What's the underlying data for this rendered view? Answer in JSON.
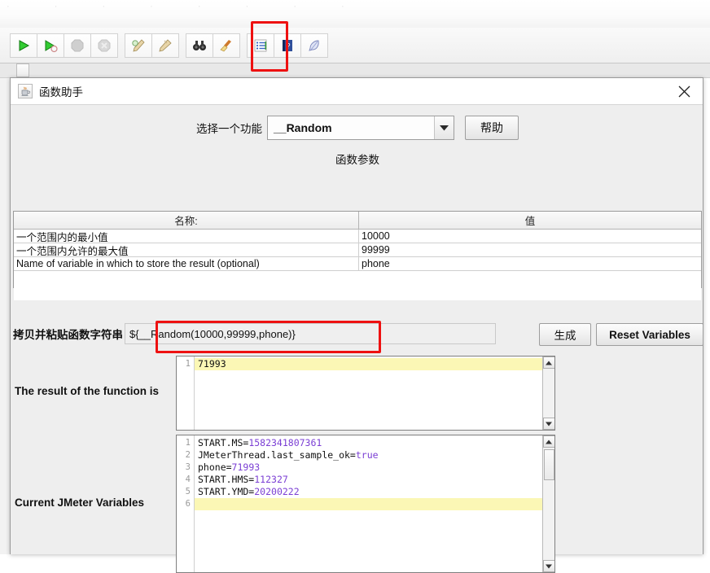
{
  "app": {
    "toolbar_buttons": [
      {
        "name": "start-button",
        "icon": "play-icon",
        "enabled": true
      },
      {
        "name": "start-no-pauses-button",
        "icon": "play-no-pause-icon",
        "enabled": true
      },
      {
        "name": "stop-button",
        "icon": "stop-octagon-icon",
        "enabled": false
      },
      {
        "name": "shutdown-button",
        "icon": "shutdown-octagon-icon",
        "enabled": false
      },
      {
        "name": "clear-button",
        "icon": "brush-clear-icon",
        "enabled": true
      },
      {
        "name": "clear-all-button",
        "icon": "brush-clear-all-icon",
        "enabled": true
      },
      {
        "name": "search-button",
        "icon": "binoculars-icon",
        "enabled": true
      },
      {
        "name": "reset-search-button",
        "icon": "broom-icon",
        "enabled": true
      },
      {
        "name": "function-helper-button",
        "icon": "bulleted-list-icon",
        "enabled": true
      },
      {
        "name": "help-button",
        "icon": "blue-question-book-icon",
        "enabled": true
      },
      {
        "name": "templates-button",
        "icon": "feather-icon",
        "enabled": true
      }
    ],
    "highlight_color": "#ee1111"
  },
  "dialog": {
    "title": "函数助手",
    "title_icon": "java-cup-icon",
    "close_icon": "close-icon",
    "select_function": {
      "label": "选择一个功能",
      "value": "__Random",
      "dropdown_icon": "chevron-down-icon"
    },
    "help_button_label": "帮助",
    "parameters": {
      "caption": "函数参数",
      "columns": [
        "名称:",
        "值"
      ],
      "rows": [
        {
          "name": "一个范围内的最小值",
          "value": "10000"
        },
        {
          "name": "一个范围内允许的最大值",
          "value": "99999"
        },
        {
          "name": "Name of variable in which to store the result (optional)",
          "value": "phone"
        }
      ]
    },
    "function_string": {
      "label": "拷贝并粘贴函数字符串",
      "value": "${__Random(10000,99999,phone)}"
    },
    "generate_button_label": "生成",
    "reset_variables_button_label": "Reset Variables",
    "result": {
      "label": "The result of the function is",
      "lines": [
        {
          "no": "1",
          "text": "71993",
          "highlight": true
        }
      ],
      "scroll_up_icon": "triangle-up-icon",
      "scroll_down_icon": "triangle-down-icon"
    },
    "variables": {
      "label": "Current JMeter Variables",
      "lines": [
        {
          "no": "1",
          "key": "START.MS=",
          "value": "1582341807361",
          "highlight": false
        },
        {
          "no": "2",
          "key": "JMeterThread.last_sample_ok=",
          "value": "true",
          "highlight": false
        },
        {
          "no": "3",
          "key": "phone=",
          "value": "71993",
          "highlight": false
        },
        {
          "no": "4",
          "key": "START.HMS=",
          "value": "112327",
          "highlight": false
        },
        {
          "no": "5",
          "key": "START.YMD=",
          "value": "20200222",
          "highlight": false
        },
        {
          "no": "6",
          "key": "",
          "value": "",
          "highlight": true
        }
      ],
      "scroll_up_icon": "triangle-up-icon",
      "scroll_down_icon": "triangle-down-icon"
    }
  },
  "colors": {
    "value_text": "#7b3fd4",
    "highlight_line": "#fbf7b5",
    "dialog_background": "#eeeeee"
  }
}
